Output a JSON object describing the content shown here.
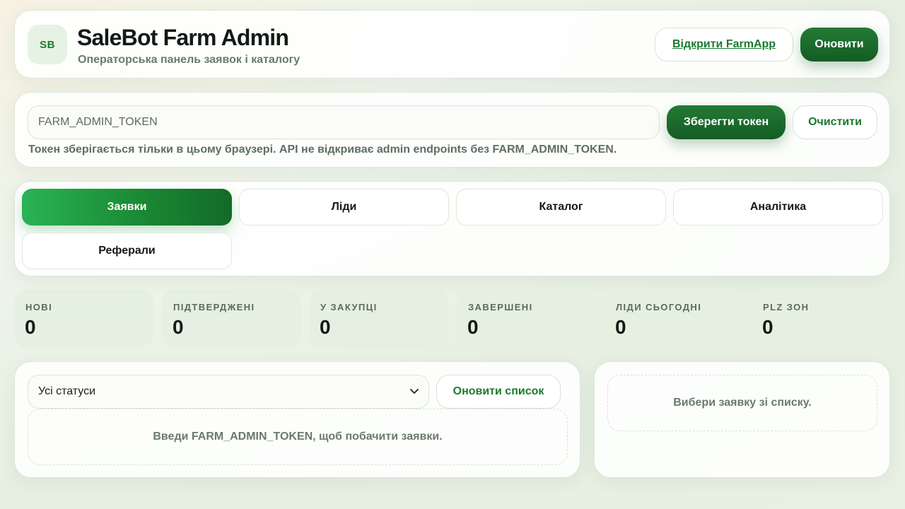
{
  "header": {
    "logo_text": "SB",
    "title": "SaleBot Farm Admin",
    "subtitle": "Операторська панель заявок і каталогу",
    "open_farmapp_label": "Відкрити FarmApp",
    "refresh_label": "Оновити"
  },
  "token": {
    "placeholder": "FARM_ADMIN_TOKEN",
    "save_label": "Зберегти токен",
    "clear_label": "Очистити",
    "note": "Токен зберігається тільки в цьому браузері. API не відкриває admin endpoints без FARM_ADMIN_TOKEN."
  },
  "tabs": [
    {
      "label": "Заявки",
      "active": true
    },
    {
      "label": "Ліди",
      "active": false
    },
    {
      "label": "Каталог",
      "active": false
    },
    {
      "label": "Аналітика",
      "active": false
    },
    {
      "label": "Реферали",
      "active": false
    }
  ],
  "stats": [
    {
      "label": "НОВІ",
      "value": "0"
    },
    {
      "label": "ПІДТВЕРДЖЕНІ",
      "value": "0"
    },
    {
      "label": "У ЗАКУПЦІ",
      "value": "0"
    },
    {
      "label": "ЗАВЕРШЕНІ",
      "value": "0"
    },
    {
      "label": "ЛІДИ СЬОГОДНІ",
      "value": "0"
    },
    {
      "label": "PLZ ЗОН",
      "value": "0"
    }
  ],
  "orders": {
    "status_filter_value": "Усі статуси",
    "reload_label": "Оновити список",
    "empty_message": "Введи FARM_ADMIN_TOKEN, щоб побачити заявки."
  },
  "detail": {
    "empty_message": "Вибери заявку зі списку."
  },
  "colors": {
    "accent": "#1a7a2d",
    "accent_dark": "#145c25",
    "tab_active_start": "#2bb356"
  }
}
